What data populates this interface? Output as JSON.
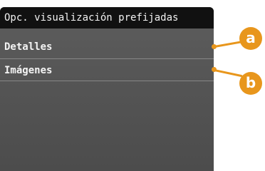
{
  "screen": {
    "title": "Opc. visualización prefijadas",
    "items": [
      {
        "label": "Detalles",
        "callout": "a"
      },
      {
        "label": "Imágenes",
        "callout": "b"
      }
    ]
  },
  "colors": {
    "callout": "#e8961c",
    "title_bar": "#111111",
    "panel": "#555555"
  }
}
